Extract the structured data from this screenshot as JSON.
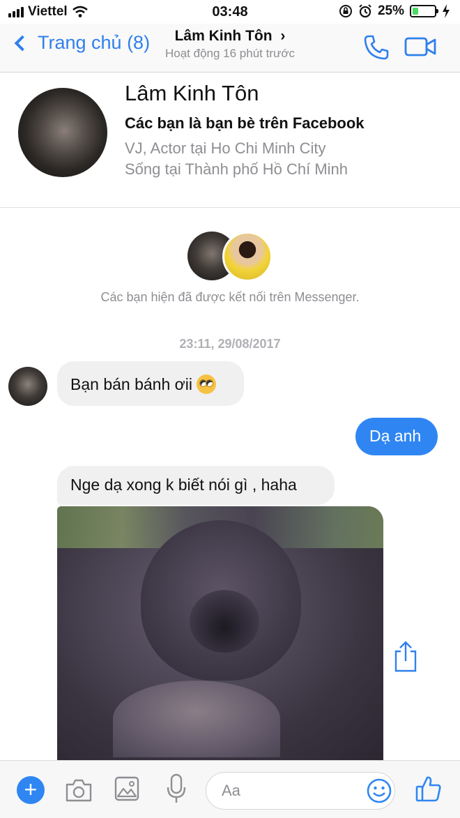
{
  "status_bar": {
    "carrier": "Viettel",
    "time": "03:48",
    "battery": "25%",
    "battery_level": 0.25
  },
  "nav": {
    "back_label": "Trang chủ (8)",
    "title": "Lâm Kinh Tôn",
    "title_chevron": "›",
    "subtitle": "Hoạt động 16 phút trước",
    "icons": [
      "phone-icon",
      "video-camera-icon"
    ]
  },
  "profile": {
    "name": "Lâm Kinh Tôn",
    "friends_text": "Các bạn là bạn bè trên Facebook",
    "job": "VJ, Actor tại Ho Chi Minh City",
    "location": "Sống tại Thành phố Hồ Chí Minh"
  },
  "connected": {
    "text": "Các bạn hiện đã được kết nối trên Messenger."
  },
  "timestamp": "23:11, 29/08/2017",
  "messages": [
    {
      "from": "them",
      "text": "Bạn bán bánh ơii",
      "emoji": "face-with-rolling-eyes"
    },
    {
      "from": "me",
      "text": "Dạ anh"
    },
    {
      "from": "them",
      "text": "Nge dạ xong k biết nói gì , haha"
    },
    {
      "from": "them",
      "type": "image",
      "subject": "gorilla"
    }
  ],
  "composer": {
    "placeholder": "Aa",
    "plus_label": "+",
    "icons": [
      "plus-icon",
      "camera-icon",
      "photo-icon",
      "microphone-icon",
      "emoji-icon",
      "thumbs-up-icon"
    ]
  },
  "colors": {
    "accent": "#2f86f3",
    "incoming_bubble": "#f0f0f0",
    "secondary_text": "#8e8e93"
  }
}
